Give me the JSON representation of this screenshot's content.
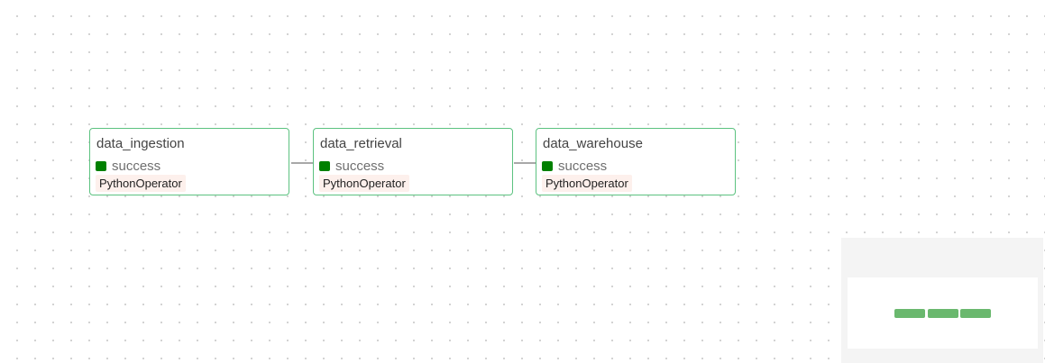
{
  "graph": {
    "nodes": [
      {
        "title": "data_ingestion",
        "state": "success",
        "operator": "PythonOperator"
      },
      {
        "title": "data_retrieval",
        "state": "success",
        "operator": "PythonOperator"
      },
      {
        "title": "data_warehouse",
        "state": "success",
        "operator": "PythonOperator"
      }
    ]
  },
  "colors": {
    "success": "#008000",
    "node_border": "#5cc280",
    "operator_bg": "#fdf0ec",
    "minimap_node": "#6ab86e",
    "edge": "#a8a8a8"
  }
}
